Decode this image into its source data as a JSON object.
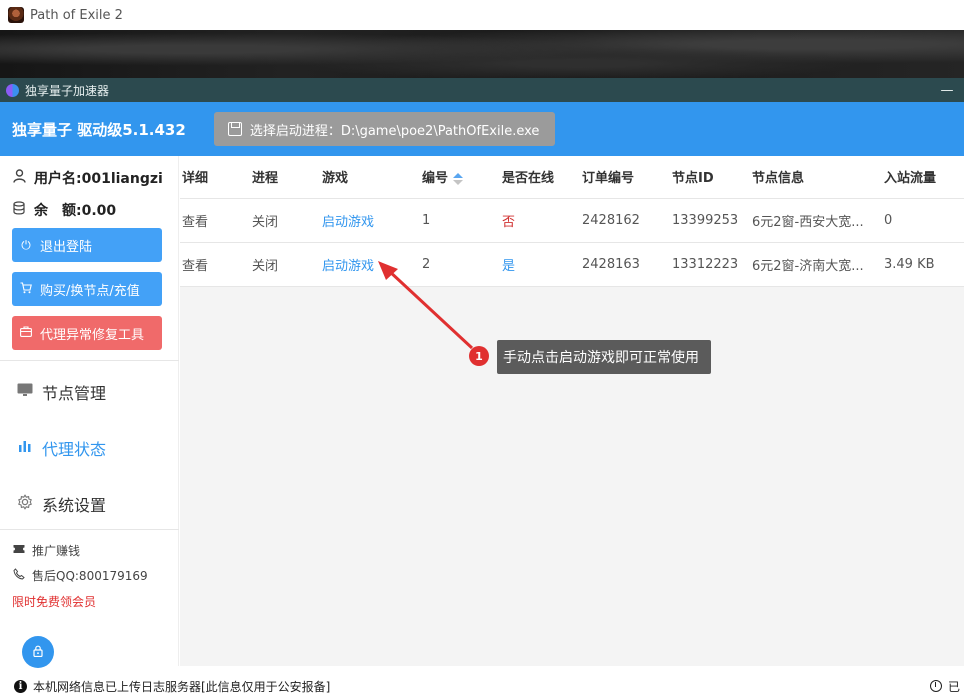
{
  "game_window": {
    "title": "Path of Exile 2"
  },
  "app_window": {
    "title": "独享量子加速器",
    "minimize_glyph": "—"
  },
  "header": {
    "brand": "独享量子 驱动级5.1.432",
    "select_process_label": "选择启动进程：D:\\game\\poe2\\PathOfExile.exe"
  },
  "sidebar": {
    "username": "用户名:001liangzi",
    "balance": "余　额:0.00",
    "buttons": {
      "logout": "退出登陆",
      "buy": "购买/换节点/充值",
      "repair": "代理异常修复工具"
    },
    "nav": {
      "nodes": "节点管理",
      "proxy_status": "代理状态",
      "settings": "系统设置"
    },
    "links": {
      "promo": "推广赚钱",
      "qq": "售后QQ:800179169",
      "vip": "限时免费领会员"
    },
    "active_nav": "proxy_status"
  },
  "table": {
    "headers": [
      "详细",
      "进程",
      "游戏",
      "编号",
      "是否在线",
      "订单编号",
      "节点ID",
      "节点信息",
      "入站流量"
    ],
    "rows": [
      {
        "detail": "查看",
        "process": "关闭",
        "game": "启动游戏",
        "number": "1",
        "online": "否",
        "order": "2428162",
        "node_id": "13399253",
        "node_info": "6元2窗-西安大宽...",
        "inbound": "0"
      },
      {
        "detail": "查看",
        "process": "关闭",
        "game": "启动游戏",
        "number": "2",
        "online": "是",
        "order": "2428163",
        "node_id": "13312223",
        "node_info": "6元2窗-济南大宽...",
        "inbound": "3.49 KB"
      }
    ]
  },
  "annotation": {
    "badge": "1",
    "text": "手动点击启动游戏即可正常使用"
  },
  "footer": {
    "info_glyph": "i",
    "notice": "本机网络信息已上传日志服务器[此信息仅用于公安报备]",
    "right_text": "已"
  },
  "colors": {
    "accent": "#3296ee",
    "danger": "#f06a6a",
    "title_bar": "#2c4a4f",
    "select_bg": "#9b9b9b"
  },
  "icons": [
    "user-icon",
    "database-icon",
    "power-icon",
    "cart-icon",
    "toolbox-icon",
    "monitor-icon",
    "bar-chart-icon",
    "gear-icon",
    "ticket-icon",
    "phone-icon",
    "lock-icon",
    "info-icon",
    "clock-icon",
    "save-icon",
    "sort-icon"
  ]
}
